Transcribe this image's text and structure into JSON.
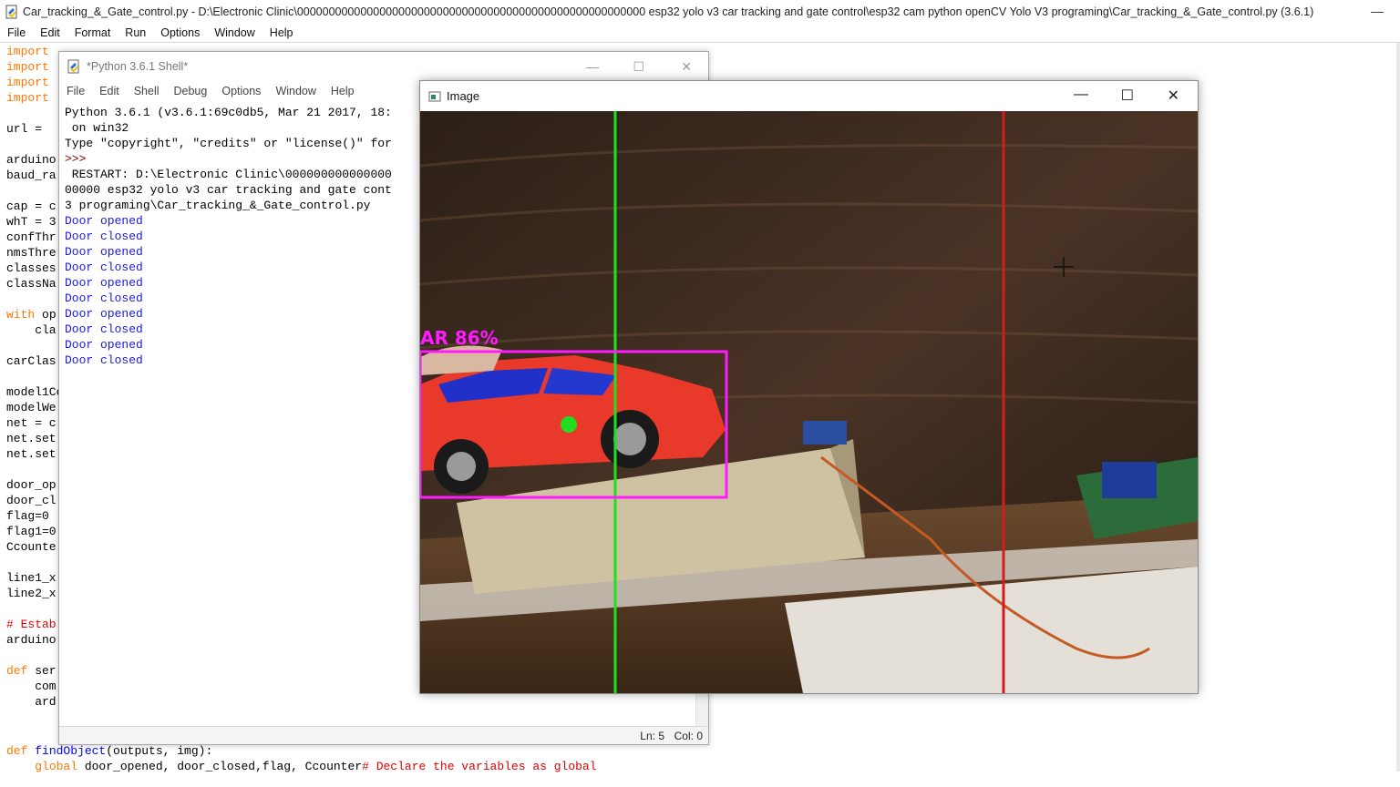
{
  "editor": {
    "title": "Car_tracking_&_Gate_control.py - D:\\Electronic Clinic\\0000000000000000000000000000000000000000000000000000000 esp32 yolo v3 car tracking and gate control\\esp32 cam python openCV Yolo V3 programing\\Car_tracking_&_Gate_control.py (3.6.1)",
    "min_glyph": "—",
    "menu": [
      "File",
      "Edit",
      "Format",
      "Run",
      "Options",
      "Window",
      "Help"
    ],
    "code_lines": [
      "import ",
      "import ",
      "import ",
      "import ",
      "",
      "url = ",
      "",
      "arduino",
      "baud_ra",
      "",
      "cap = c",
      "whT = 3",
      "confThr",
      "nmsThre",
      "classes",
      "classNa",
      "",
      "with op",
      "    cla",
      "",
      "carClas",
      "",
      "model1Co",
      "modelWe",
      "net = c",
      "net.set",
      "net.set",
      "",
      "door_op",
      "door_cl",
      "flag=0",
      "flag1=0",
      "Ccounte",
      "",
      "line1_x",
      "line2_x",
      "",
      "# Estab",
      "arduino",
      "",
      "def ser",
      "    com",
      "    ard"
    ],
    "bottom_def": "def",
    "bottom_fn": "findObject",
    "bottom_args": "(outputs, img):",
    "bottom_global": "global",
    "bottom_vars": " door_opened, door_closed,flag, Ccounter",
    "bottom_comment": "# Declare the variables as global"
  },
  "shell": {
    "title": "*Python 3.6.1 Shell*",
    "menu": [
      "File",
      "Edit",
      "Shell",
      "Debug",
      "Options",
      "Window",
      "Help"
    ],
    "min_glyph": "—",
    "max_glyph": "☐",
    "close_glyph": "✕",
    "header_lines": [
      "Python 3.6.1 (v3.6.1:69c0db5, Mar 21 2017, 18:",
      " on win32",
      "Type \"copyright\", \"credits\" or \"license()\" for"
    ],
    "prompt": ">>>",
    "restart_lines": [
      " RESTART: D:\\Electronic Clinic\\000000000000000",
      "00000 esp32 yolo v3 car tracking and gate cont",
      "3 programing\\Car_tracking_&_Gate_control.py"
    ],
    "output": [
      "Door opened",
      "Door closed",
      "Door opened",
      "Door closed",
      "Door opened",
      "Door closed",
      "Door opened",
      "Door closed",
      "Door opened",
      "Door closed"
    ],
    "status_ln": "Ln: 5",
    "status_col": "Col: 0"
  },
  "image_window": {
    "title": "Image",
    "min_glyph": "—",
    "max_glyph": "☐",
    "close_glyph": "✕",
    "detection_label": "AR 86%",
    "colors": {
      "green_line": "#1ee21e",
      "red_line": "#d81a1a",
      "bbox": "#ff1aff",
      "center_dot": "#22dd22"
    }
  }
}
